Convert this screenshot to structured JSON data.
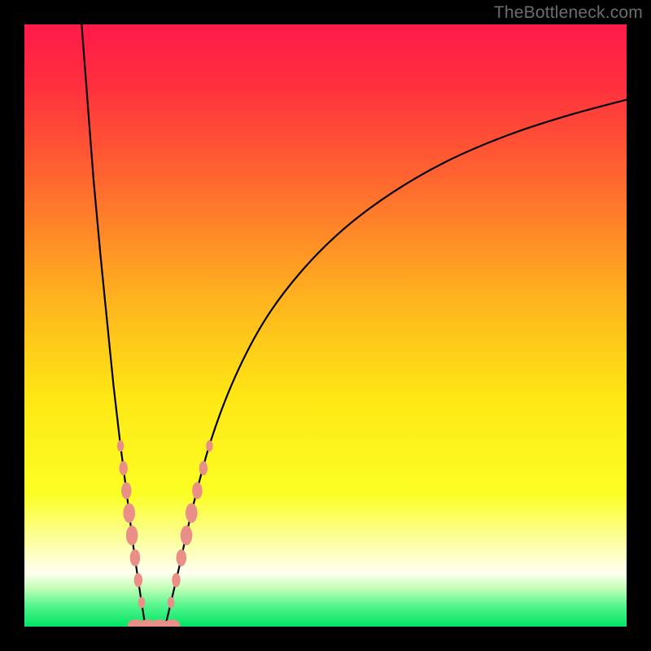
{
  "watermark": "TheBottleneck.com",
  "chart_data": {
    "type": "line",
    "title": "",
    "xlabel": "",
    "ylabel": "",
    "xlim": [
      0,
      100
    ],
    "ylim": [
      0,
      100
    ],
    "gradient_stops": [
      {
        "pos": 0.0,
        "color": "#ff1a49"
      },
      {
        "pos": 0.1,
        "color": "#ff2f3e"
      },
      {
        "pos": 0.25,
        "color": "#ff6430"
      },
      {
        "pos": 0.45,
        "color": "#ffb11f"
      },
      {
        "pos": 0.62,
        "color": "#ffe714"
      },
      {
        "pos": 0.78,
        "color": "#fbff24"
      },
      {
        "pos": 0.88,
        "color": "#fdffc2"
      },
      {
        "pos": 0.91,
        "color": "#ffffef"
      },
      {
        "pos": 0.935,
        "color": "#c7ffba"
      },
      {
        "pos": 0.965,
        "color": "#56f58d"
      },
      {
        "pos": 1.0,
        "color": "#00e564"
      }
    ],
    "series": [
      {
        "name": "left-branch",
        "x": [
          9.5,
          10.5,
          11.5,
          12.6,
          13.7,
          14.8,
          15.9,
          17.0,
          18.0,
          19.0,
          20.0
        ],
        "y": [
          100,
          87,
          74,
          62,
          51,
          40,
          30.5,
          22,
          14,
          7,
          0.5
        ]
      },
      {
        "name": "right-branch",
        "x": [
          23.5,
          25.5,
          28.0,
          31.0,
          35.0,
          40.0,
          46.0,
          53.0,
          61.0,
          70.0,
          80.0,
          90.0,
          100.0
        ],
        "y": [
          0.5,
          9,
          20,
          31,
          41.5,
          51,
          59,
          66,
          72,
          77.2,
          81.5,
          84.8,
          87.5
        ]
      }
    ],
    "minimum_floor": {
      "x": [
        19.5,
        24.0
      ],
      "y": 0.3
    },
    "beads_left": {
      "x": 16.0,
      "y_range": [
        4,
        30
      ],
      "count": 8
    },
    "beads_right": {
      "x": 26.5,
      "y_range": [
        4,
        30
      ],
      "count": 8
    },
    "beads_bottom_x": [
      18.5,
      20.5,
      22.5,
      24.5
    ]
  }
}
